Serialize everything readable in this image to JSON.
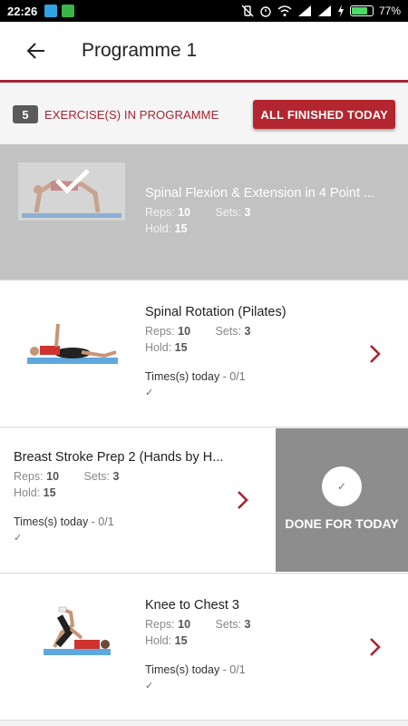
{
  "status_bar": {
    "time": "22:26",
    "battery": "77%",
    "battery_level": 0.77
  },
  "app_bar": {
    "title": "Programme 1",
    "back_icon": "arrow-back-icon"
  },
  "programme": {
    "count": "5",
    "label": "EXERCISE(S) IN PROGRAMME",
    "finish_button": "ALL FINISHED TODAY"
  },
  "exercises": [
    {
      "name": "Spinal Flexion & Extension in 4 Point ...",
      "reps_label": "Reps:",
      "reps": "10",
      "sets_label": "Sets:",
      "sets": "3",
      "hold_label": "Hold:",
      "hold": "15",
      "completed": true
    },
    {
      "name": "Spinal Rotation (Pilates)",
      "reps_label": "Reps:",
      "reps": "10",
      "sets_label": "Sets:",
      "sets": "3",
      "hold_label": "Hold:",
      "hold": "15",
      "times_label": "Times(s) today",
      "times_value": " - 0/1",
      "tick": "✓"
    },
    {
      "name": "Breast Stroke Prep 2 (Hands by H...",
      "reps_label": "Reps:",
      "reps": "10",
      "sets_label": "Sets:",
      "sets": "3",
      "hold_label": "Hold:",
      "hold": "15",
      "times_label": "Times(s) today",
      "times_value": " - 0/1",
      "tick": "✓",
      "done_label": "DONE FOR TODAY",
      "done_check": "✓"
    },
    {
      "name": "Knee to Chest 3",
      "reps_label": "Reps:",
      "reps": "10",
      "sets_label": "Sets:",
      "sets": "3",
      "hold_label": "Hold:",
      "hold": "15",
      "times_label": "Times(s) today",
      "times_value": " - 0/1",
      "tick": "✓"
    }
  ],
  "colors": {
    "accent": "#a72431",
    "button": "#b3262f",
    "done_panel": "#8d8d8d"
  }
}
